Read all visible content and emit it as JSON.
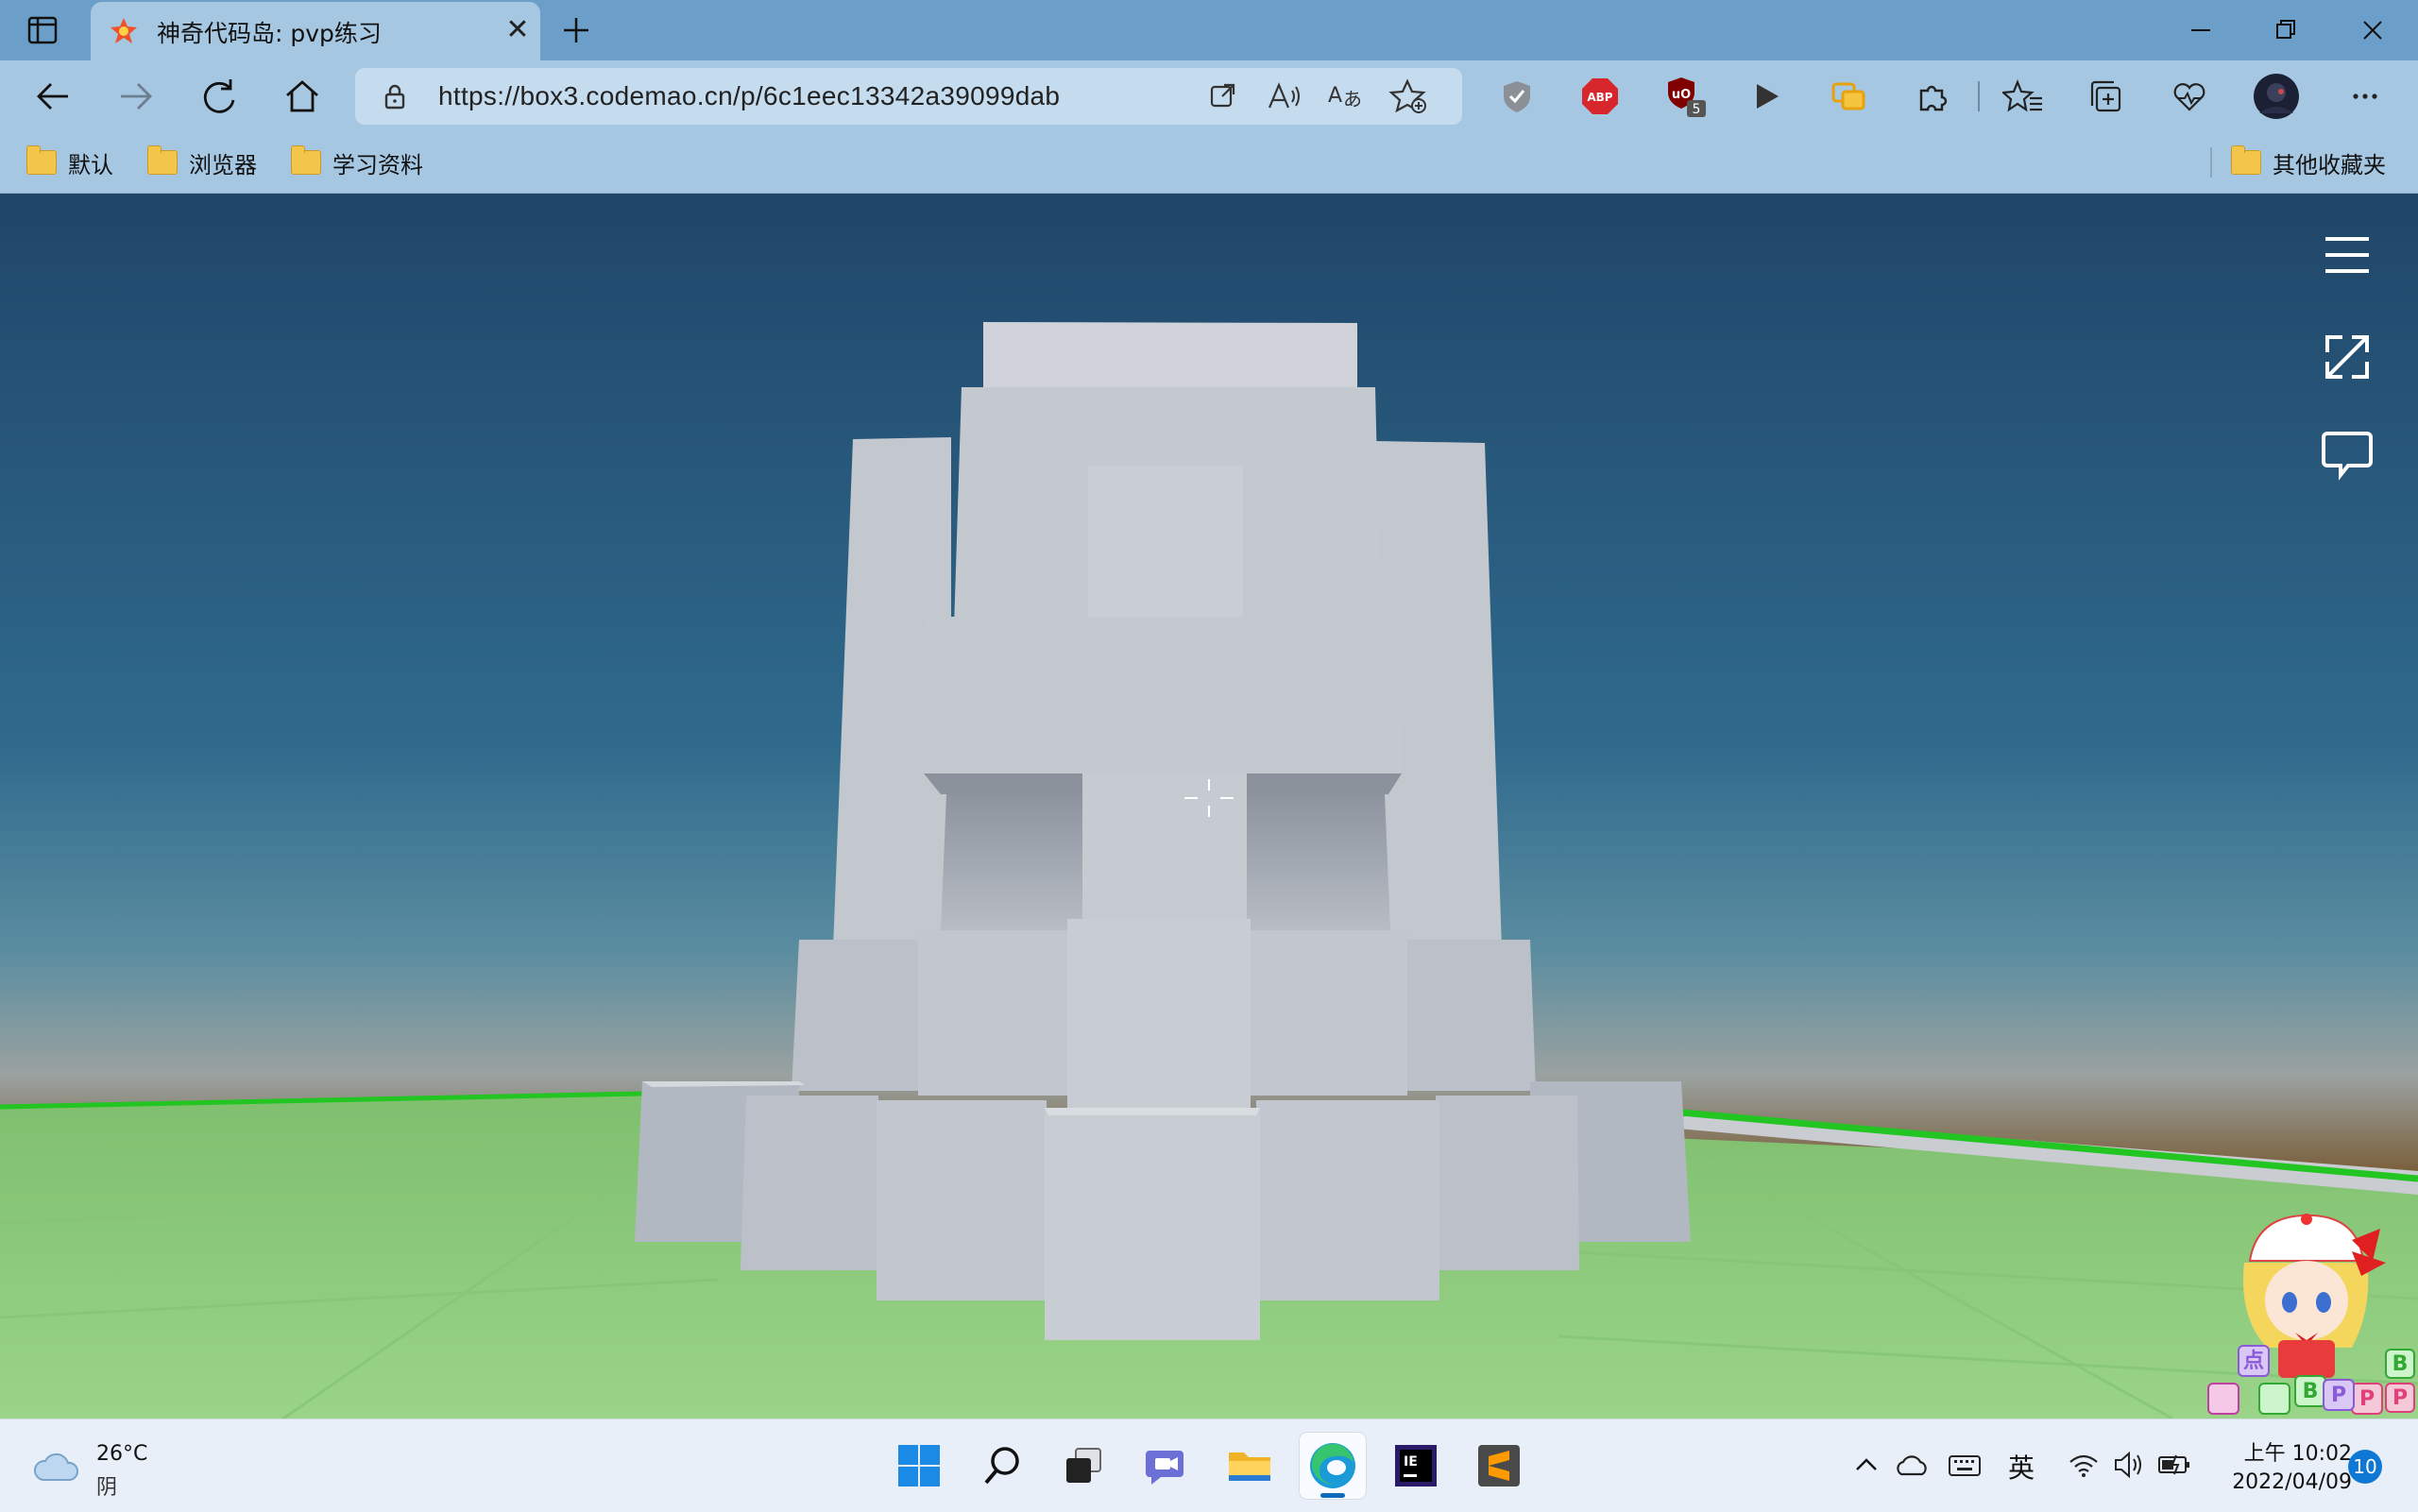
{
  "browser": {
    "tab_title": "神奇代码岛: pvp练习",
    "url": "https://box3.codemao.cn/p/6c1eec13342a39099dab",
    "extension_badge_count": "5",
    "bookmarks": [
      "默认",
      "浏览器",
      "学习资料"
    ],
    "other_bookmarks": "其他收藏夹",
    "brand_color": "#6b9fc9"
  },
  "game": {
    "menu_icon": "hamburger-menu-icon",
    "fullscreen_icon": "expand-icon",
    "chat_icon": "chat-bubble-icon",
    "mascot_letters": [
      "点",
      "B",
      "P",
      "P",
      "B",
      "P"
    ]
  },
  "taskbar": {
    "weather_temp": "26°C",
    "weather_desc": "阴",
    "input_lang": "英",
    "time": "上午 10:02",
    "date": "2022/04/09",
    "notification_count": "10"
  }
}
